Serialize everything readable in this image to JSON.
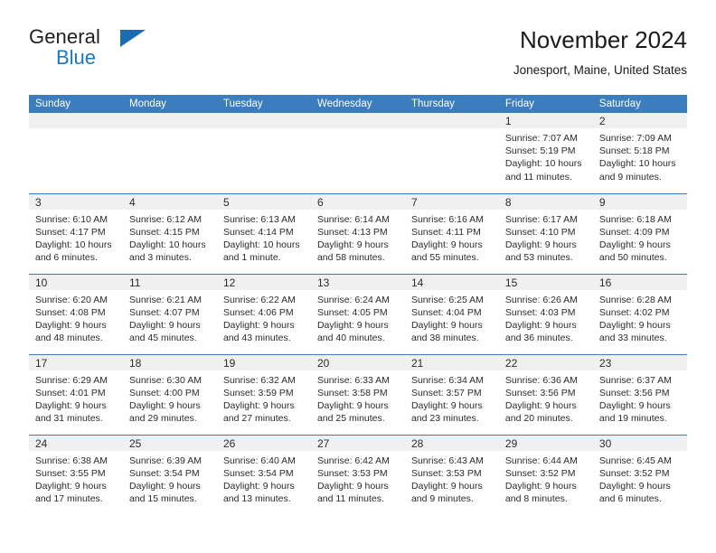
{
  "brand": {
    "name_part1": "General",
    "name_part2": "Blue",
    "accent_color": "#1b77c4",
    "triangle_color": "#1b6cb0"
  },
  "header": {
    "title": "November 2024",
    "subtitle": "Jonesport, Maine, United States"
  },
  "theme": {
    "header_blue": "#3b7dbd",
    "daynum_band": "#f0f0f0",
    "text": "#2b2b2b"
  },
  "weekday_headers": [
    "Sunday",
    "Monday",
    "Tuesday",
    "Wednesday",
    "Thursday",
    "Friday",
    "Saturday"
  ],
  "labels": {
    "sunrise_prefix": "Sunrise:",
    "sunset_prefix": "Sunset:",
    "daylight_prefix": "Daylight:"
  },
  "weeks": [
    [
      {
        "day": "",
        "blank": true
      },
      {
        "day": "",
        "blank": true
      },
      {
        "day": "",
        "blank": true
      },
      {
        "day": "",
        "blank": true
      },
      {
        "day": "",
        "blank": true
      },
      {
        "day": "1",
        "sunrise": "Sunrise: 7:07 AM",
        "sunset": "Sunset: 5:19 PM",
        "daylight": "Daylight: 10 hours and 11 minutes."
      },
      {
        "day": "2",
        "sunrise": "Sunrise: 7:09 AM",
        "sunset": "Sunset: 5:18 PM",
        "daylight": "Daylight: 10 hours and 9 minutes."
      }
    ],
    [
      {
        "day": "3",
        "sunrise": "Sunrise: 6:10 AM",
        "sunset": "Sunset: 4:17 PM",
        "daylight": "Daylight: 10 hours and 6 minutes."
      },
      {
        "day": "4",
        "sunrise": "Sunrise: 6:12 AM",
        "sunset": "Sunset: 4:15 PM",
        "daylight": "Daylight: 10 hours and 3 minutes."
      },
      {
        "day": "5",
        "sunrise": "Sunrise: 6:13 AM",
        "sunset": "Sunset: 4:14 PM",
        "daylight": "Daylight: 10 hours and 1 minute."
      },
      {
        "day": "6",
        "sunrise": "Sunrise: 6:14 AM",
        "sunset": "Sunset: 4:13 PM",
        "daylight": "Daylight: 9 hours and 58 minutes."
      },
      {
        "day": "7",
        "sunrise": "Sunrise: 6:16 AM",
        "sunset": "Sunset: 4:11 PM",
        "daylight": "Daylight: 9 hours and 55 minutes."
      },
      {
        "day": "8",
        "sunrise": "Sunrise: 6:17 AM",
        "sunset": "Sunset: 4:10 PM",
        "daylight": "Daylight: 9 hours and 53 minutes."
      },
      {
        "day": "9",
        "sunrise": "Sunrise: 6:18 AM",
        "sunset": "Sunset: 4:09 PM",
        "daylight": "Daylight: 9 hours and 50 minutes."
      }
    ],
    [
      {
        "day": "10",
        "sunrise": "Sunrise: 6:20 AM",
        "sunset": "Sunset: 4:08 PM",
        "daylight": "Daylight: 9 hours and 48 minutes."
      },
      {
        "day": "11",
        "sunrise": "Sunrise: 6:21 AM",
        "sunset": "Sunset: 4:07 PM",
        "daylight": "Daylight: 9 hours and 45 minutes."
      },
      {
        "day": "12",
        "sunrise": "Sunrise: 6:22 AM",
        "sunset": "Sunset: 4:06 PM",
        "daylight": "Daylight: 9 hours and 43 minutes."
      },
      {
        "day": "13",
        "sunrise": "Sunrise: 6:24 AM",
        "sunset": "Sunset: 4:05 PM",
        "daylight": "Daylight: 9 hours and 40 minutes."
      },
      {
        "day": "14",
        "sunrise": "Sunrise: 6:25 AM",
        "sunset": "Sunset: 4:04 PM",
        "daylight": "Daylight: 9 hours and 38 minutes."
      },
      {
        "day": "15",
        "sunrise": "Sunrise: 6:26 AM",
        "sunset": "Sunset: 4:03 PM",
        "daylight": "Daylight: 9 hours and 36 minutes."
      },
      {
        "day": "16",
        "sunrise": "Sunrise: 6:28 AM",
        "sunset": "Sunset: 4:02 PM",
        "daylight": "Daylight: 9 hours and 33 minutes."
      }
    ],
    [
      {
        "day": "17",
        "sunrise": "Sunrise: 6:29 AM",
        "sunset": "Sunset: 4:01 PM",
        "daylight": "Daylight: 9 hours and 31 minutes."
      },
      {
        "day": "18",
        "sunrise": "Sunrise: 6:30 AM",
        "sunset": "Sunset: 4:00 PM",
        "daylight": "Daylight: 9 hours and 29 minutes."
      },
      {
        "day": "19",
        "sunrise": "Sunrise: 6:32 AM",
        "sunset": "Sunset: 3:59 PM",
        "daylight": "Daylight: 9 hours and 27 minutes."
      },
      {
        "day": "20",
        "sunrise": "Sunrise: 6:33 AM",
        "sunset": "Sunset: 3:58 PM",
        "daylight": "Daylight: 9 hours and 25 minutes."
      },
      {
        "day": "21",
        "sunrise": "Sunrise: 6:34 AM",
        "sunset": "Sunset: 3:57 PM",
        "daylight": "Daylight: 9 hours and 23 minutes."
      },
      {
        "day": "22",
        "sunrise": "Sunrise: 6:36 AM",
        "sunset": "Sunset: 3:56 PM",
        "daylight": "Daylight: 9 hours and 20 minutes."
      },
      {
        "day": "23",
        "sunrise": "Sunrise: 6:37 AM",
        "sunset": "Sunset: 3:56 PM",
        "daylight": "Daylight: 9 hours and 19 minutes."
      }
    ],
    [
      {
        "day": "24",
        "sunrise": "Sunrise: 6:38 AM",
        "sunset": "Sunset: 3:55 PM",
        "daylight": "Daylight: 9 hours and 17 minutes."
      },
      {
        "day": "25",
        "sunrise": "Sunrise: 6:39 AM",
        "sunset": "Sunset: 3:54 PM",
        "daylight": "Daylight: 9 hours and 15 minutes."
      },
      {
        "day": "26",
        "sunrise": "Sunrise: 6:40 AM",
        "sunset": "Sunset: 3:54 PM",
        "daylight": "Daylight: 9 hours and 13 minutes."
      },
      {
        "day": "27",
        "sunrise": "Sunrise: 6:42 AM",
        "sunset": "Sunset: 3:53 PM",
        "daylight": "Daylight: 9 hours and 11 minutes."
      },
      {
        "day": "28",
        "sunrise": "Sunrise: 6:43 AM",
        "sunset": "Sunset: 3:53 PM",
        "daylight": "Daylight: 9 hours and 9 minutes."
      },
      {
        "day": "29",
        "sunrise": "Sunrise: 6:44 AM",
        "sunset": "Sunset: 3:52 PM",
        "daylight": "Daylight: 9 hours and 8 minutes."
      },
      {
        "day": "30",
        "sunrise": "Sunrise: 6:45 AM",
        "sunset": "Sunset: 3:52 PM",
        "daylight": "Daylight: 9 hours and 6 minutes."
      }
    ]
  ]
}
